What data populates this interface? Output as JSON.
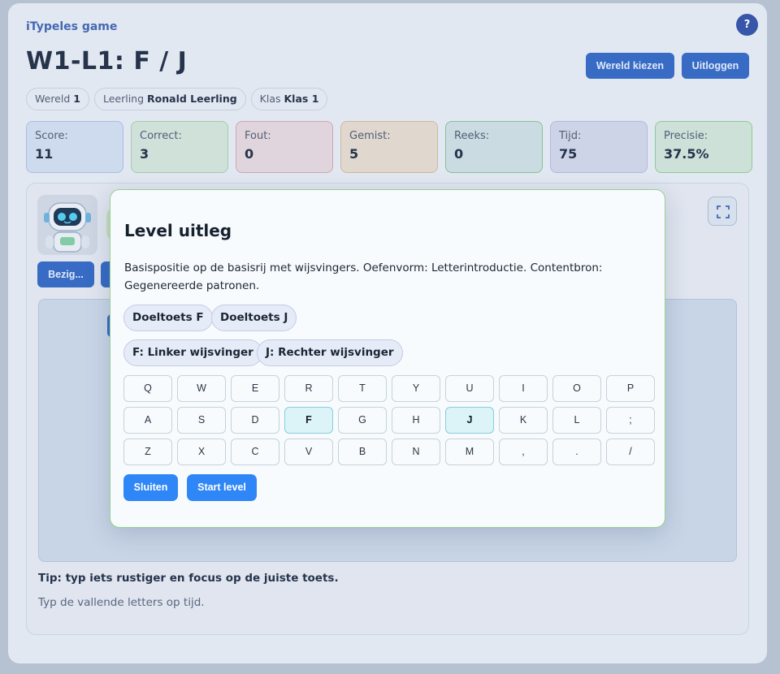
{
  "app": {
    "brand": "iTypeles game",
    "help_label": "?",
    "title": "W1-L1: F / J",
    "buttons": {
      "world": "Wereld kiezen",
      "logout": "Uitloggen"
    },
    "chips": [
      {
        "label": "Wereld",
        "value": "1"
      },
      {
        "label": "Leerling",
        "value": "Ronald Leerling"
      },
      {
        "label": "Klas",
        "value": "Klas 1"
      }
    ]
  },
  "stats": [
    {
      "label": "Score:",
      "value": "11"
    },
    {
      "label": "Correct:",
      "value": "3"
    },
    {
      "label": "Fout:",
      "value": "0"
    },
    {
      "label": "Gemist:",
      "value": "5"
    },
    {
      "label": "Reeks:",
      "value": "0"
    },
    {
      "label": "Tijd:",
      "value": "75"
    },
    {
      "label": "Precisie:",
      "value": "37.5%"
    }
  ],
  "game": {
    "busy_label": "Bezig...",
    "tip": "Tip: typ iets rustiger en focus op de juiste toets.",
    "hint": "Typ de vallende letters op tijd."
  },
  "modal": {
    "title": "Level uitleg",
    "description": "Basispositie op de basisrij met wijsvingers. Oefenvorm: Letterintroductie. Contentbron: Gegenereerde patronen.",
    "target_keys": [
      "Doeltoets F",
      "Doeltoets J"
    ],
    "fingers": [
      "F: Linker wijsvinger",
      "J: Rechter wijsvinger"
    ],
    "keyboard": {
      "row1": [
        "Q",
        "W",
        "E",
        "R",
        "T",
        "Y",
        "U",
        "I",
        "O",
        "P"
      ],
      "row2": [
        "A",
        "S",
        "D",
        "F",
        "G",
        "H",
        "J",
        "K",
        "L",
        ";"
      ],
      "row3": [
        "Z",
        "X",
        "C",
        "V",
        "B",
        "N",
        "M",
        ",",
        ".",
        "/"
      ]
    },
    "highlighted_keys": [
      "F",
      "J"
    ],
    "close_label": "Sluiten",
    "start_label": "Start level"
  },
  "colors": {
    "primary": "#2f67c4",
    "modal_button": "#2f86f6",
    "modal_border": "#98d18e",
    "target_key": "#dcf3f8"
  }
}
